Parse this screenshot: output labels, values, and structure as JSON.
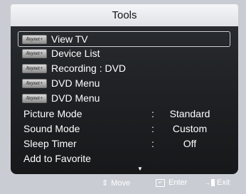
{
  "header": {
    "title": "Tools"
  },
  "menu": {
    "anynet_badge": "Anynet+",
    "items": [
      {
        "label": "View TV"
      },
      {
        "label": "Device List"
      },
      {
        "label": "Recording : DVD"
      },
      {
        "label": "DVD Menu"
      },
      {
        "label": "DVD Menu"
      }
    ],
    "settings": [
      {
        "name": "Picture Mode",
        "colon": ":",
        "value": "Standard"
      },
      {
        "name": "Sound Mode",
        "colon": ":",
        "value": "Custom"
      },
      {
        "name": "Sleep Timer",
        "colon": ":",
        "value": "Off"
      }
    ],
    "favorite": "Add to Favorite",
    "more_arrow": "▼"
  },
  "footer": {
    "move_icon": "⇕",
    "move": "Move",
    "enter": "Enter",
    "exit": "Exit"
  }
}
